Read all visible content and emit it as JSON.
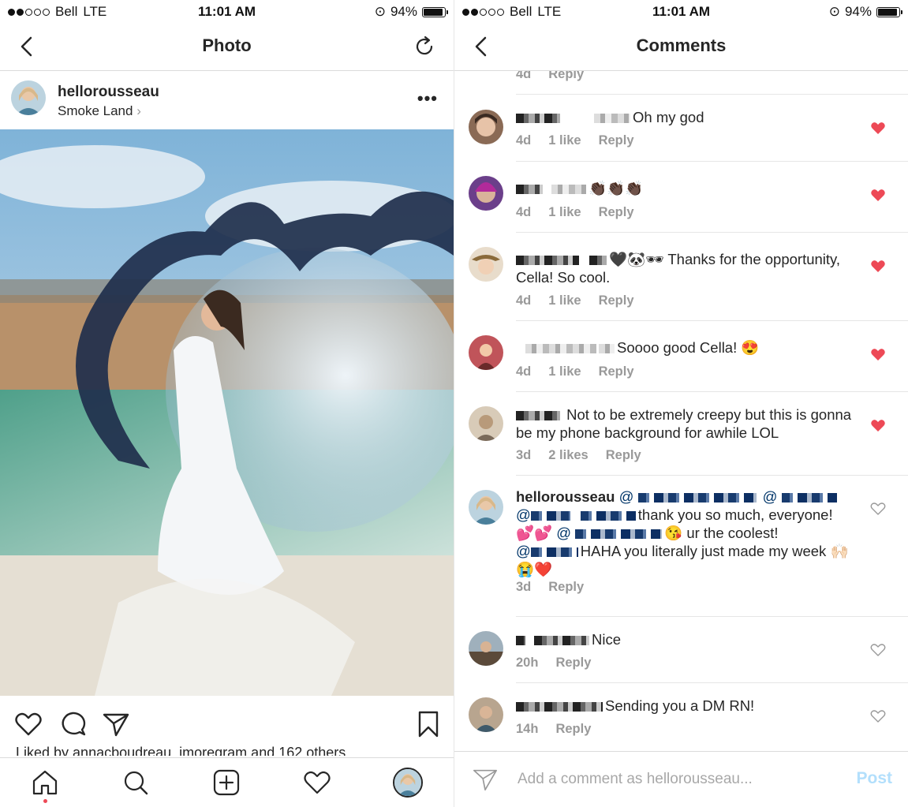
{
  "status_bar": {
    "carrier": "Bell",
    "network": "LTE",
    "time": "11:01 AM",
    "battery": "94%"
  },
  "left": {
    "nav": {
      "title": "Photo"
    },
    "post": {
      "username": "hellorousseau",
      "location": "Smoke Land",
      "more": "•••"
    },
    "liked_by": "Liked by annacboudreau, jmoregram and 162 others"
  },
  "right": {
    "nav": {
      "title": "Comments"
    },
    "partial_meta": {
      "time": "4d",
      "reply": "Reply"
    },
    "comments": [
      {
        "text": "Oh my god",
        "time": "4d",
        "likes": "1 like",
        "reply": "Reply",
        "liked": true
      },
      {
        "text": "👏🏿👏🏿👏🏿",
        "time": "4d",
        "likes": "1 like",
        "reply": "Reply",
        "liked": true
      },
      {
        "text": "🖤🐼🕶 Thanks for the opportunity, Cella! So cool.",
        "time": "4d",
        "likes": "1 like",
        "reply": "Reply",
        "liked": true
      },
      {
        "text": "Soooo good Cella! 😍",
        "time": "4d",
        "likes": "1 like",
        "reply": "Reply",
        "liked": true
      },
      {
        "text": "Not to be extremely creepy but this is gonna be my phone background for awhile LOL",
        "time": "3d",
        "likes": "2 likes",
        "reply": "Reply",
        "liked": true
      },
      {
        "username": "hellorousseau",
        "part1": "thank you so much, everyone!",
        "part2": "💕💕",
        "part3": "😘 ur the coolest!",
        "part4": "HAHA you literally just made my week 🙌🏻😭❤️",
        "time": "3d",
        "reply": "Reply",
        "liked": false
      },
      {
        "text": "Nice",
        "time": "20h",
        "reply": "Reply",
        "liked": false
      },
      {
        "text": "Sending you a DM RN!",
        "time": "14h",
        "reply": "Reply",
        "liked": false
      }
    ],
    "input": {
      "placeholder": "Add a comment as hellorousseau...",
      "post_label": "Post"
    }
  },
  "colors": {
    "heart_red": "#ed4956",
    "post_disabled": "#b2dffc",
    "meta_gray": "#999999"
  },
  "icons": [
    "back-arrow-icon",
    "refresh-icon",
    "more-icon",
    "heart-icon",
    "comment-icon",
    "share-icon",
    "bookmark-icon",
    "home-icon",
    "search-icon",
    "add-icon",
    "activity-icon",
    "profile-icon",
    "send-icon"
  ]
}
